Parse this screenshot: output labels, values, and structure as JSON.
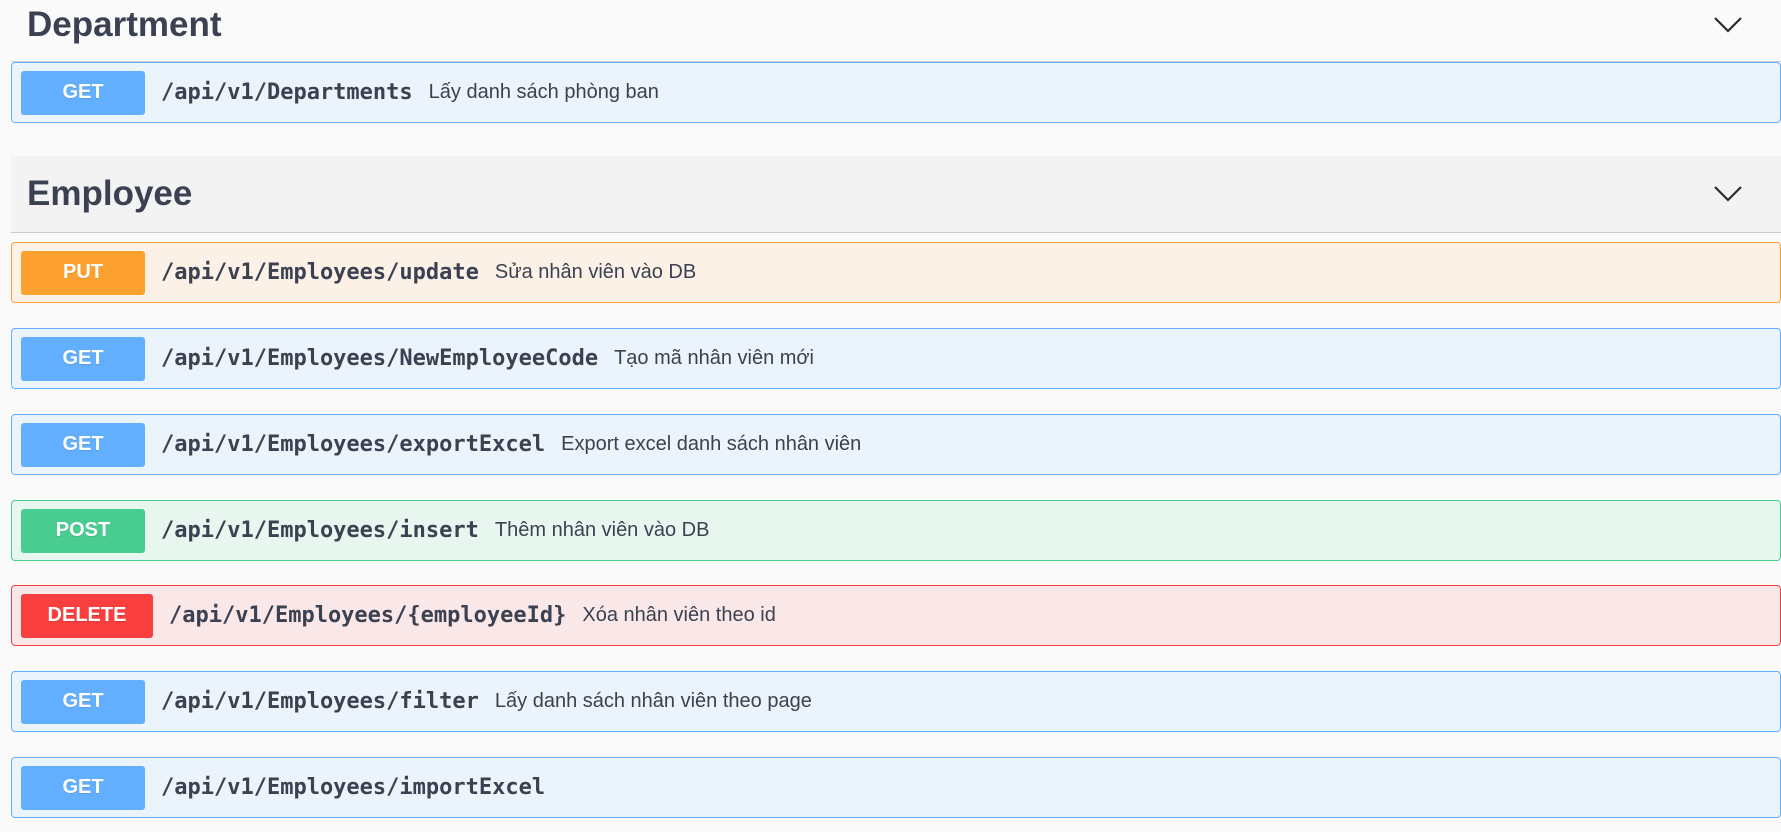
{
  "sections": [
    {
      "title": "Department",
      "chevron_icon": "chevron-down-icon",
      "operations": [
        {
          "method": "GET",
          "path": "/api/v1/Departments",
          "summary": "Lấy danh sách phòng ban"
        }
      ]
    },
    {
      "title": "Employee",
      "chevron_icon": "chevron-down-icon",
      "operations": [
        {
          "method": "PUT",
          "path": "/api/v1/Employees/update",
          "summary": "Sửa nhân viên vào DB"
        },
        {
          "method": "GET",
          "path": "/api/v1/Employees/NewEmployeeCode",
          "summary": "Tạo mã nhân viên mới"
        },
        {
          "method": "GET",
          "path": "/api/v1/Employees/exportExcel",
          "summary": "Export excel danh sách nhân viên"
        },
        {
          "method": "POST",
          "path": "/api/v1/Employees/insert",
          "summary": "Thêm nhân viên vào DB"
        },
        {
          "method": "DELETE",
          "path": "/api/v1/Employees/{employeeId}",
          "summary": "Xóa nhân viên theo id"
        },
        {
          "method": "GET",
          "path": "/api/v1/Employees/filter",
          "summary": "Lấy danh sách nhân viên theo page"
        },
        {
          "method": "GET",
          "path": "/api/v1/Employees/importExcel",
          "summary": ""
        }
      ]
    }
  ],
  "colors": {
    "get": "#61affe",
    "put": "#fca130",
    "post": "#49cc90",
    "delete": "#f93e3e",
    "text": "#3b4151"
  }
}
